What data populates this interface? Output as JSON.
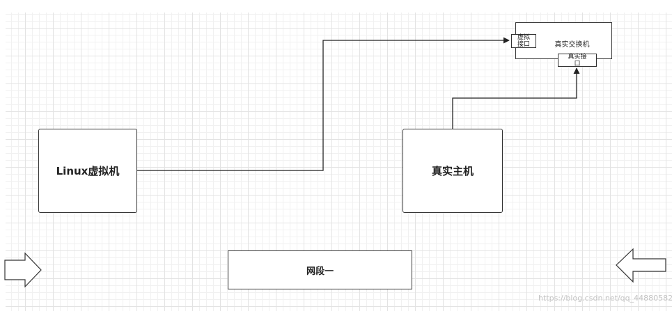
{
  "nodes": {
    "linux_vm": "Linux虚拟机",
    "real_host": "真实主机",
    "segment": "网段一",
    "switch": "真实交换机",
    "virtual_port": "虚拟\n接口",
    "real_port": "真实接\n口"
  },
  "colors": {
    "line": "#222222",
    "border": "#333333",
    "grid_major": "#e3e3e3",
    "grid_minor": "#f1f1f1"
  },
  "icons": {
    "left_arrow": "right-arrow-icon",
    "right_arrow": "left-arrow-icon"
  },
  "watermark": "https://blog.csdn.net/qq_44880582"
}
